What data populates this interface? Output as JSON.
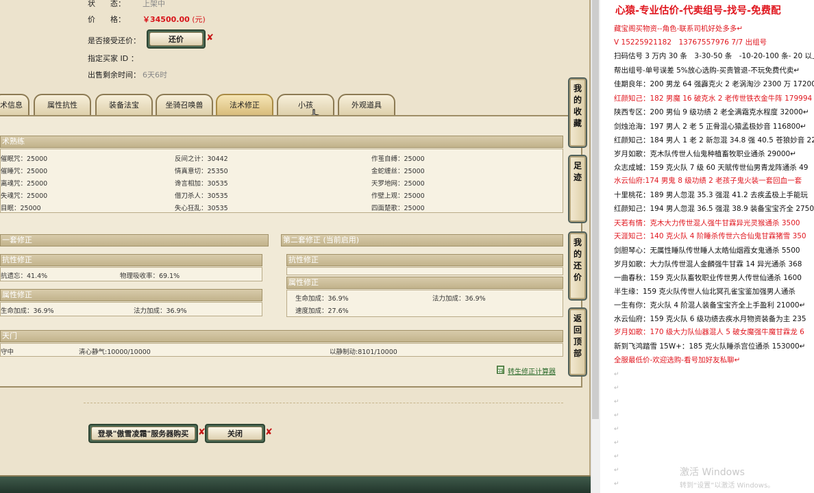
{
  "listing": {
    "status_label": "状　　态：",
    "status_value": "上架中",
    "price_label": "价　　格：",
    "price_value": "￥34500.00",
    "price_unit": "(元)",
    "counter_label": "是否接受还价：",
    "counter_button": "还价",
    "buyer_label": "指定买家 ID ：",
    "remaining_label": "出售剩余时间：",
    "remaining_value": "6天6时",
    "x_mark": "✘"
  },
  "tabs": [
    "术信息",
    "属性抗性",
    "装备法宝",
    "坐骑召唤兽",
    "法术修正",
    "小孩",
    "外观道具"
  ],
  "active_tab": "法术修正",
  "skills": {
    "header": "术熟练",
    "rows": [
      [
        "催眠咒：25000",
        "反间之计：30442",
        "作茧自缚：25000"
      ],
      [
        "催睡咒：25000",
        "情真意切：25350",
        "金蛇缠丝：25000"
      ],
      [
        "离魂咒：25000",
        "谗言相加：30535",
        "天罗地网：25000"
      ],
      [
        "失魂咒：25000",
        "借刀杀人：30535",
        "作壁上观：25000"
      ],
      [
        "目眠：25000",
        "失心狂乱：30535",
        "四面楚歌：25000"
      ]
    ]
  },
  "set1": {
    "header": "一套修正",
    "resist_header": "抗性修正",
    "resist_values": [
      "抗遗忘：41.4%",
      "物理吸收率：69.1%"
    ],
    "attr_header": "属性修正",
    "attr_values": [
      "生命加成：36.9%",
      "法力加成：36.9%"
    ]
  },
  "set2": {
    "header": "第二套修正 (当前启用)",
    "resist_header": "抗性修正",
    "attr_header": "属性修正",
    "attr_values": [
      "生命加成：36.9%",
      "法力加成：36.9%",
      "速度加成：27.6%"
    ]
  },
  "school": {
    "header": "天门",
    "values": [
      "守中",
      "清心静气:10000/10000",
      "以静制动:8101/10000"
    ]
  },
  "calc_link": "转生修正计算器",
  "bottom_buttons": {
    "login_buy": "登录\"傲雪凌霜\"服务器购买",
    "close": "关闭"
  },
  "side_buttons": [
    "我的收藏",
    "足迹",
    "我的还价",
    "返回顶部"
  ],
  "document": {
    "title": "心猿-专业估价-代卖组号-找号-免费配",
    "lines": [
      {
        "text": "藏宝阁买物资--角色-联系司机好处多多↵",
        "red": true
      },
      {
        "text": "V 15225921182　13767557976 7/7 出组号",
        "red": true
      },
      {
        "text": "扫码估号 3 万内 30 条　3-30-50 条　-10-20-100 条- 20 以上 1",
        "red": false
      },
      {
        "text": "帮出组号-单号误差 5%放心选购-买贵管退-不玩免费代卖↵",
        "red": false
      },
      {
        "text": "佳期良年：200 男龙 64 强霹克火 2 老涡淘沙 2300 万 17200",
        "red": false
      },
      {
        "text": "红颜知己：182 男魔 16 破克水 2 老传世铁衣金牛阵 179994",
        "red": true
      },
      {
        "text": "陕西专区：200 男仙 9 级功绩 2 老全满霜克水程度 32000↵",
        "red": false
      },
      {
        "text": "剑烛沧海：197 男人 2 老 5 正骨混心猿孟极妙音 116800↵",
        "red": false
      },
      {
        "text": "红颜知己：184 男人 1 老 2 新忽混 34.8 强 40.5 苍狼妙音 22",
        "red": false
      },
      {
        "text": "岁月如歌：克木队传世人仙鬼种植畜牧职业通杀 29000↵",
        "red": false
      },
      {
        "text": "众志成城：159 克火队 7 级 60 天赋传世仙男青龙阵通杀 49",
        "red": false
      },
      {
        "text": "水云仙府:174 男鬼 8 级功绩 2 老孩子鬼火装一套回血一套",
        "red": true
      },
      {
        "text": "十里桃花：189 男人忽混 35.3 强混 41.2 去疾孟极上手能玩",
        "red": false
      },
      {
        "text": "红颜知己：194 男人忽混 36.5 强混 38.9 装备宝宝齐全 2750",
        "red": false
      },
      {
        "text": "天若有情：克木大力传世混人强牛甘霖异光灵猴通杀 3500",
        "red": true
      },
      {
        "text": "天涯知己：140 克火队 4 阶睡杀传世六合仙鬼甘霖猪雪 350",
        "red": true
      },
      {
        "text": "剑胆琴心：无属性睡队传世睡人太皓仙烟霞女鬼通杀 5500",
        "red": false
      },
      {
        "text": "岁月如歌：大力队传世混人金麟强牛甘霖 14 异光通杀 368",
        "red": false
      },
      {
        "text": "一曲春秋：159 克火队畜牧职业传世男人传世仙通杀 1600",
        "red": false
      },
      {
        "text": "半生缘：159 克火队传世人仙北冥孔雀宝鉴加强男人通杀",
        "red": false
      },
      {
        "text": "一生有你：克火队 4 阶混人装备宝宝齐全上手盈利 21000↵",
        "red": false
      },
      {
        "text": "水云仙府：159 克火队 6 级功绩去疾水月物资装备为主 235",
        "red": false
      },
      {
        "text": "岁月如歌：170 级大力队仙器混人 5 破女魔强牛魔甘霖龙 6",
        "red": true
      },
      {
        "text": "新到飞鸿踏雪 15W+：185 克火队睡杀宫位通杀 153000↵",
        "red": false
      },
      {
        "text": "全服最低价-欢迎选购-看号加好友私聊↵",
        "red": true
      }
    ],
    "para_mark": "↵",
    "activation_title": "激活 Windows",
    "activation_sub": "转到“设置”以激活 Windows。"
  }
}
